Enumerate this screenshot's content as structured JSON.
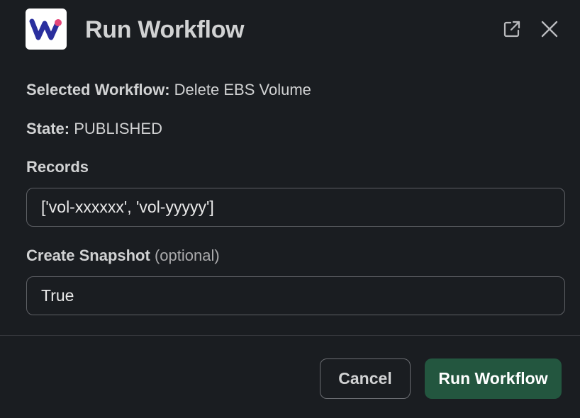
{
  "header": {
    "title": "Run Workflow",
    "logo_icon": "workflow-logo-icon",
    "open_icon": "open-external-icon",
    "close_icon": "close-icon"
  },
  "info": {
    "workflow_label": "Selected Workflow:",
    "workflow_value": "Delete EBS Volume",
    "state_label": "State:",
    "state_value": "PUBLISHED"
  },
  "fields": {
    "records": {
      "label": "Records",
      "value": "['vol-xxxxxx', 'vol-yyyyy']"
    },
    "snapshot": {
      "label": "Create Snapshot",
      "optional": "(optional)",
      "value": "True"
    }
  },
  "footer": {
    "cancel_label": "Cancel",
    "run_label": "Run Workflow"
  },
  "colors": {
    "background": "#1a1d21",
    "primary_button": "#23563f",
    "logo_blue": "#2a2f9e",
    "logo_pink": "#e4477a"
  }
}
